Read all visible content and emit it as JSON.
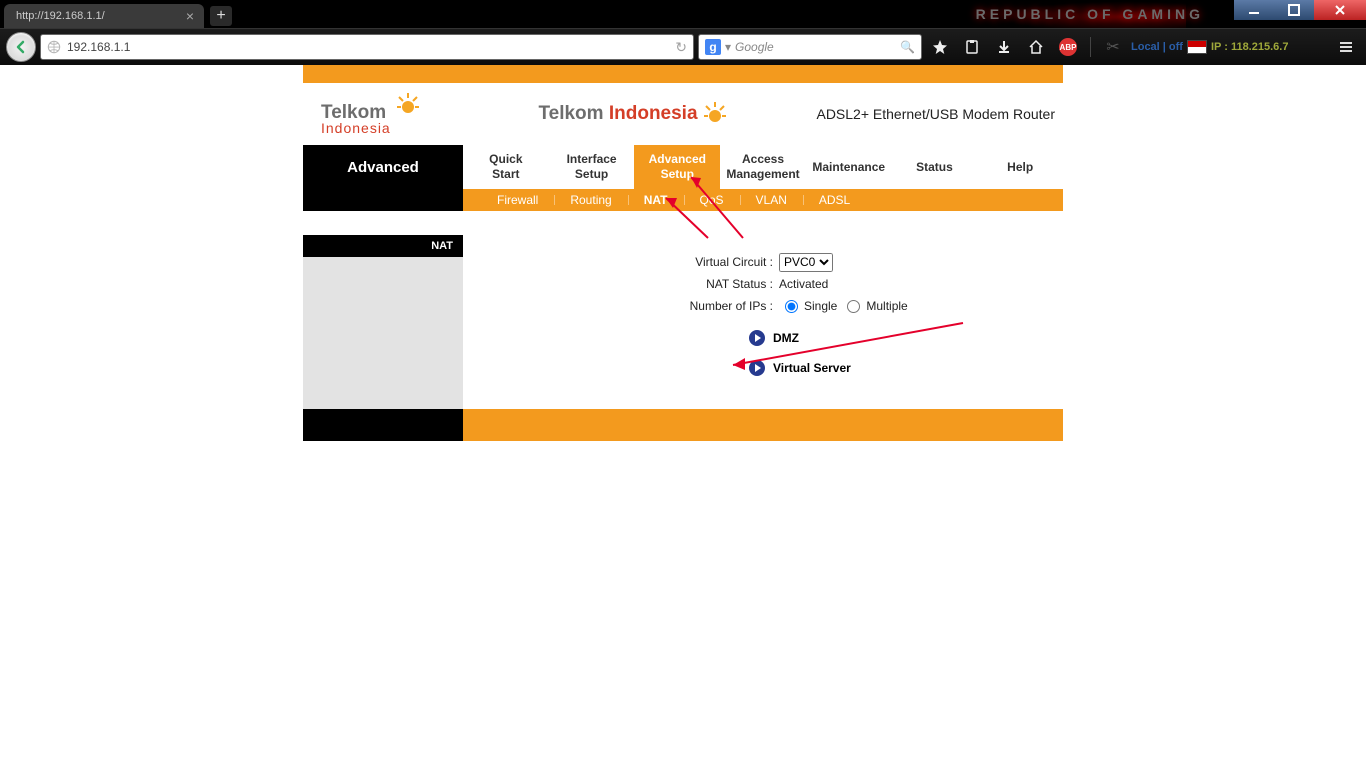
{
  "browser": {
    "tab_title": "http://192.168.1.1/",
    "url": "192.168.1.1",
    "search_placeholder": "Google",
    "brand": "REPUBLIC OF GAMING",
    "proxy_label": "Local | off",
    "ip_label": "IP : 118.215.6.7"
  },
  "router": {
    "brand_grey": "Telkom",
    "brand_red": "Indonesia",
    "device_title": "ADSL2+ Ethernet/USB Modem Router",
    "section_title": "Advanced",
    "tabs": [
      {
        "line1": "Quick",
        "line2": "Start"
      },
      {
        "line1": "Interface",
        "line2": "Setup"
      },
      {
        "line1": "Advanced",
        "line2": "Setup"
      },
      {
        "line1": "Access",
        "line2": "Management"
      },
      {
        "line1": "Maintenance",
        "line2": ""
      },
      {
        "line1": "Status",
        "line2": ""
      },
      {
        "line1": "Help",
        "line2": ""
      }
    ],
    "subnav": [
      "Firewall",
      "Routing",
      "NAT",
      "QoS",
      "VLAN",
      "ADSL"
    ],
    "side_header": "NAT",
    "form": {
      "vc_label": "Virtual Circuit :",
      "vc_value": "PVC0",
      "nat_label": "NAT Status :",
      "nat_value": "Activated",
      "ips_label": "Number of IPs :",
      "ips_single": "Single",
      "ips_multiple": "Multiple"
    },
    "links": {
      "dmz": "DMZ",
      "vs": "Virtual Server"
    }
  }
}
